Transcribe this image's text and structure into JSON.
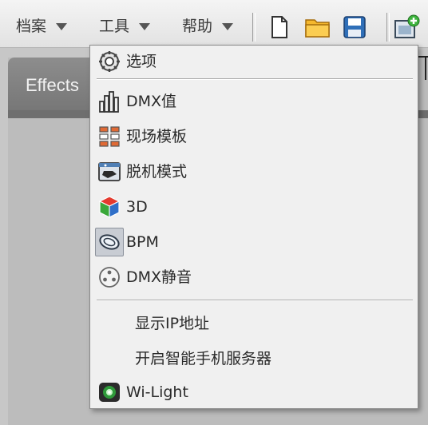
{
  "menubar": {
    "file_label": "档案",
    "tools_label": "工具",
    "help_label": "帮助"
  },
  "toolbar": {
    "new_icon": "new-file-icon",
    "open_icon": "open-folder-icon",
    "save_icon": "save-icon",
    "extra_icon": "add-window-icon"
  },
  "workspace": {
    "tab_label": "Effects"
  },
  "dropdown": {
    "items": [
      {
        "label": "选项",
        "icon": "gear-icon"
      },
      {
        "label": "DMX值",
        "icon": "bar-chart-icon"
      },
      {
        "label": "现场模板",
        "icon": "grid-template-icon"
      },
      {
        "label": "脱机模式",
        "icon": "offline-icon"
      },
      {
        "label": "3D",
        "icon": "cube-3d-icon"
      },
      {
        "label": "BPM",
        "icon": "bpm-disc-icon"
      },
      {
        "label": "DMX静音",
        "icon": "dmx-mute-icon"
      },
      {
        "label": "显示IP地址",
        "icon": ""
      },
      {
        "label": "开启智能手机服务器",
        "icon": ""
      },
      {
        "label": "Wi-Light",
        "icon": "wi-light-icon"
      }
    ]
  },
  "colors": {
    "menu_background": "#f0f0f0",
    "folder_yellow": "#f5b82e",
    "save_blue": "#2f6fb8"
  }
}
